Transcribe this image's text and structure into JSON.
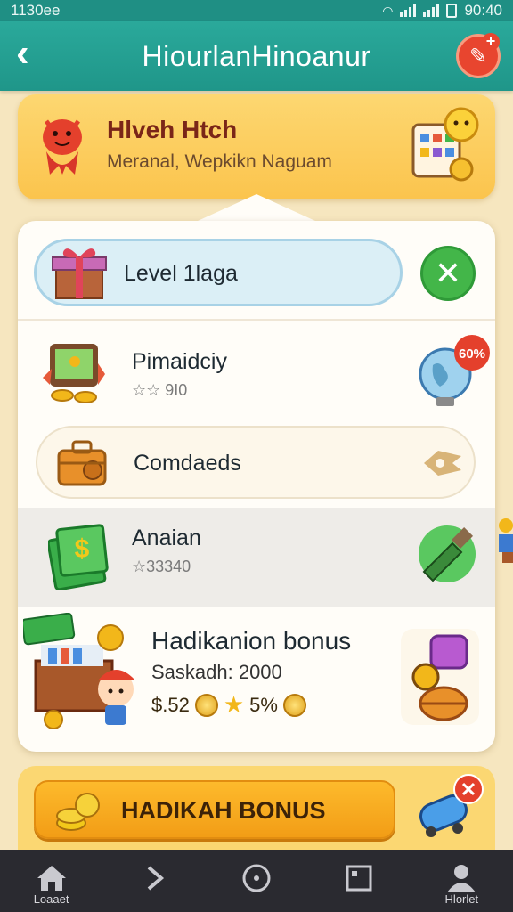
{
  "status_bar": {
    "time": "1130ee",
    "right_text": "90:40"
  },
  "header": {
    "title": "HiourlanHinoanur",
    "back_icon": "chevron-left-icon",
    "action_icon": "edit-plus-icon"
  },
  "profile": {
    "name": "Hlveh Htch",
    "subtitle": "Meranal, Wepkikn Naguam"
  },
  "level": {
    "label": "Level 1laga"
  },
  "rows": [
    {
      "title": "Pimaidciy",
      "meta": "☆☆ 9I0",
      "badge": "60%"
    },
    {
      "title": "Comdaeds"
    },
    {
      "title": "Anaian",
      "meta": "☆33340"
    }
  ],
  "bonus": {
    "title": "Hadikanion bonus",
    "subtitle": "Saskadh: 2000",
    "stat_1": "$.52",
    "stat_2": "5%"
  },
  "cta": {
    "label": "HADIKAH BONUS"
  },
  "nav": [
    {
      "icon": "home-icon",
      "label": "Loaaet"
    },
    {
      "icon": "chevron-right-icon",
      "label": ""
    },
    {
      "icon": "circle-icon",
      "label": ""
    },
    {
      "icon": "square-icon",
      "label": ""
    },
    {
      "icon": "person-icon",
      "label": "Hlorlet"
    }
  ],
  "colors": {
    "teal": "#1f9689",
    "gold": "#fbc44d",
    "green": "#43b649",
    "red": "#e8452f"
  }
}
